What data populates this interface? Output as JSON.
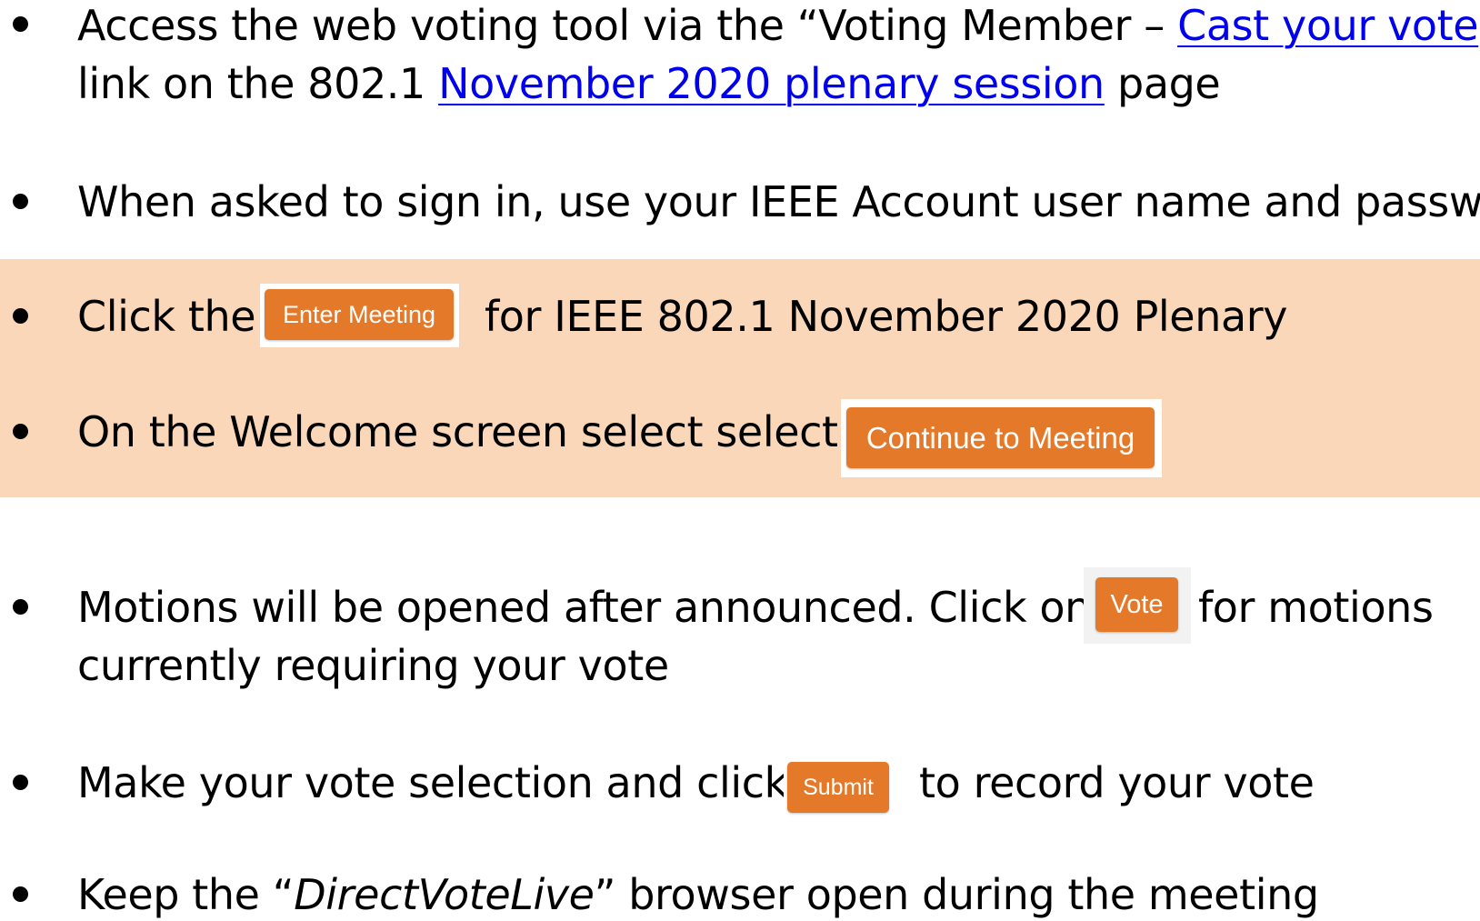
{
  "bullets": [
    {
      "line1_prefix": "Access the web voting tool via the “Voting Member – ",
      "line1_link": "Cast your vote",
      "line1_suffix": "”",
      "line2_prefix": "link on the 802.1 ",
      "line2_link": "November 2020 plenary session",
      "line2_suffix": " page"
    },
    {
      "text": "When asked to sign in, use your IEEE Account user name and password"
    },
    {
      "prefix": "Click the",
      "button_label": "Enter Meeting",
      "suffix": "for IEEE 802.1 November 2020 Plenary"
    },
    {
      "prefix": "On the Welcome screen select  select",
      "button_label": "Continue to Meeting"
    },
    {
      "line1_prefix": "Motions will be opened after announced.  Click on",
      "button_label": "Vote",
      "line1_suffix": "for motions",
      "line2": "currently requiring your vote"
    },
    {
      "prefix": "Make your vote selection and click",
      "button_label": "Submit",
      "suffix": "to record your vote"
    },
    {
      "prefix": "Keep the “",
      "italic": "DirectVoteLive",
      "suffix": "” browser open during the meeting"
    }
  ],
  "colors": {
    "highlight_band": "#fad7b8",
    "button_orange": "#e5792a",
    "link_blue": "#0000ee"
  }
}
